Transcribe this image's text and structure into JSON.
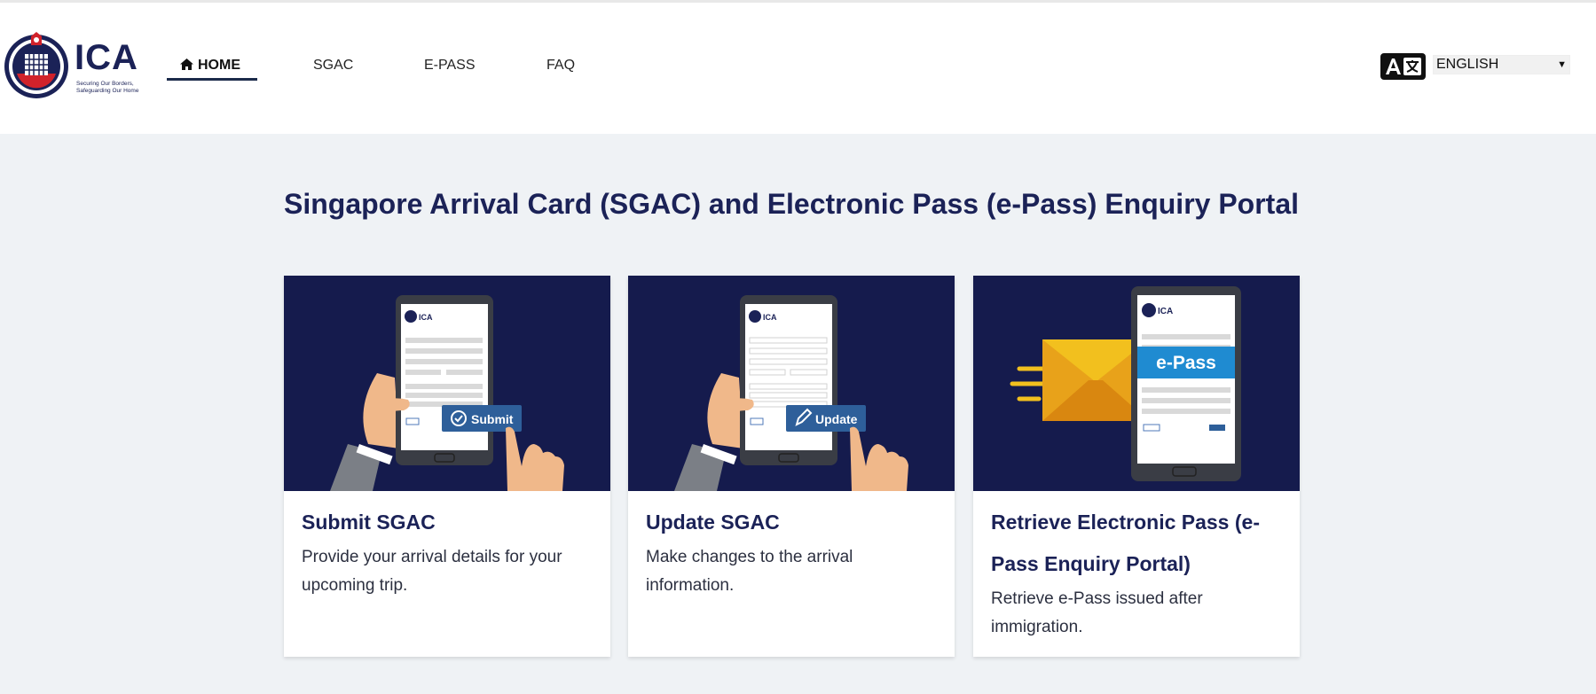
{
  "header": {
    "logo_text": "ICA",
    "logo_tagline_1": "Securing Our Borders,",
    "logo_tagline_2": "Safeguarding Our Home"
  },
  "nav": {
    "items": [
      {
        "label": "HOME",
        "icon": "home-icon",
        "active": true
      },
      {
        "label": "SGAC"
      },
      {
        "label": "E-PASS"
      },
      {
        "label": "FAQ"
      }
    ]
  },
  "language": {
    "icon": "translate-icon",
    "selected": "ENGLISH"
  },
  "page": {
    "title": "Singapore Arrival Card (SGAC) and Electronic Pass (e-Pass) Enquiry Portal"
  },
  "cards": [
    {
      "title": "Submit SGAC",
      "description": "Provide your arrival details for your upcoming trip.",
      "image_button": "Submit",
      "image_logo": "ICA"
    },
    {
      "title": "Update SGAC",
      "description": "Make changes to the arrival information.",
      "image_button": "Update",
      "image_logo": "ICA"
    },
    {
      "title": "Retrieve Electronic Pass (e-Pass Enquiry Portal)",
      "description": "Retrieve e-Pass issued after immigration.",
      "image_banner": "e-Pass",
      "image_logo": "ICA"
    }
  ],
  "colors": {
    "brand_navy": "#1b2257",
    "card_image_bg": "#151b4d",
    "page_bg": "#eff2f5",
    "accent_red": "#d1222b"
  }
}
